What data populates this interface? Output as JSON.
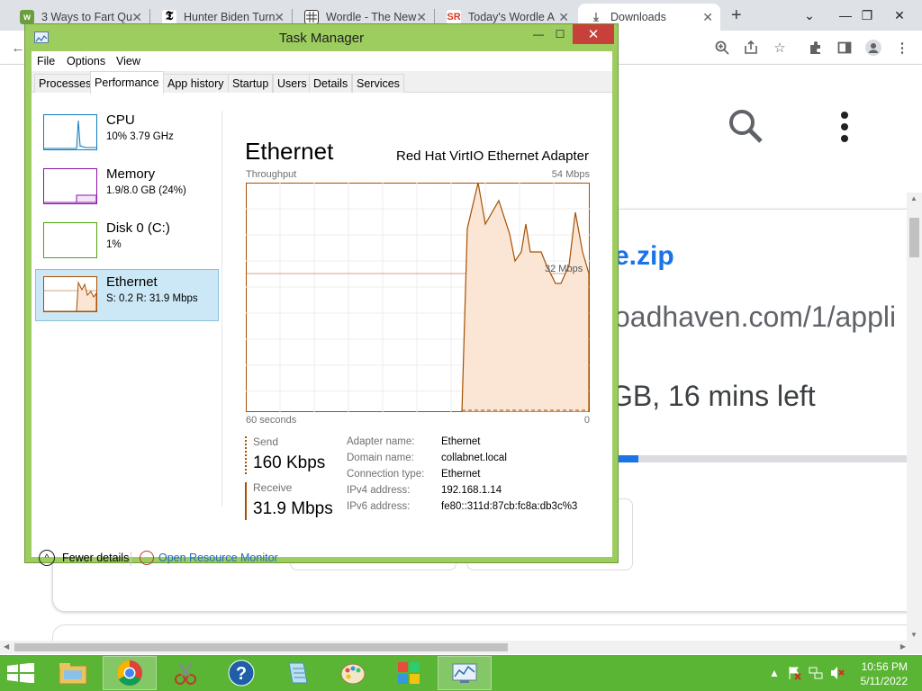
{
  "browser": {
    "tabs": [
      {
        "title": "3 Ways to Fart Qu",
        "favicon": "wikihow-icon",
        "fav_color": "#6b9e3f"
      },
      {
        "title": "Hunter Biden Turn",
        "favicon": "nyt-icon",
        "fav_color": "#000000"
      },
      {
        "title": "Wordle - The New",
        "favicon": "wordle-grid-icon",
        "fav_color": "#333333"
      },
      {
        "title": "Today's Wordle A",
        "favicon": "sportsrush-icon",
        "fav_color": "#d93a2b"
      },
      {
        "title": "Downloads",
        "favicon": "download-icon",
        "fav_color": "#5f6368"
      }
    ],
    "new_tab": "+",
    "window_controls": {
      "dropdown": "⌄",
      "minimize": "—",
      "maximize": "❐",
      "close": "✕"
    }
  },
  "download": {
    "name_fragment": "e.zip",
    "url_fragment": "oadhaven.com/1/appli",
    "status_fragment": "GB, 16 mins left",
    "progress": 0.14
  },
  "taskmgr": {
    "title": "Task Manager",
    "close": "✕",
    "minimize": "—",
    "maximize": "☐",
    "menu": [
      "File",
      "Options",
      "View"
    ],
    "tabs": [
      "Processes",
      "Performance",
      "App history",
      "Startup",
      "Users",
      "Details",
      "Services"
    ],
    "active_tab": "Performance",
    "sidebar": [
      {
        "name": "CPU",
        "sub": "10%  3.79 GHz",
        "color": "#117dbb"
      },
      {
        "name": "Memory",
        "sub": "1.9/8.0 GB (24%)",
        "color": "#8b12ae"
      },
      {
        "name": "Disk 0 (C:)",
        "sub": "1%",
        "color": "#4da60c"
      },
      {
        "name": "Ethernet",
        "sub": "S: 0.2  R: 31.9 Mbps",
        "color": "#a74f01"
      }
    ],
    "panel": {
      "title": "Ethernet",
      "adapter": "Red Hat VirtIO Ethernet Adapter",
      "throughput_label": "Throughput",
      "max_label": "54 Mbps",
      "mid_label": "32 Mbps",
      "time_left": "60 seconds",
      "time_right": "0",
      "send_label": "Send",
      "send_value": "160 Kbps",
      "receive_label": "Receive",
      "receive_value": "31.9 Mbps",
      "properties": [
        {
          "key": "Adapter name:",
          "value": "Ethernet"
        },
        {
          "key": "Domain name:",
          "value": "collabnet.local"
        },
        {
          "key": "Connection type:",
          "value": "Ethernet"
        },
        {
          "key": "IPv4 address:",
          "value": "192.168.1.14"
        },
        {
          "key": "IPv6 address:",
          "value": "fe80::311d:87cb:fc8a:db3c%3"
        }
      ]
    },
    "footer": {
      "fewer": "Fewer details",
      "resource_monitor": "Open Resource Monitor"
    }
  },
  "taskbar": {
    "clock_time": "10:56 PM",
    "clock_date": "5/11/2022",
    "color": "#5bb535"
  }
}
